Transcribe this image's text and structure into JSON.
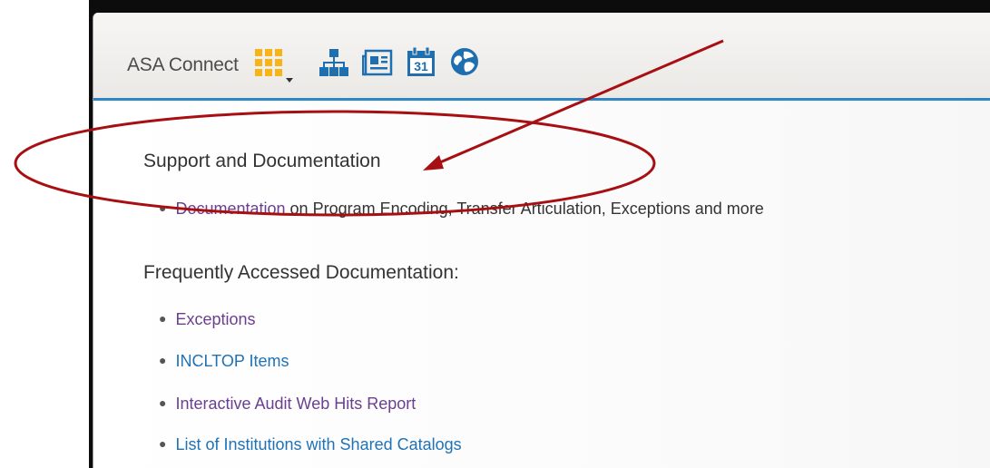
{
  "header": {
    "app_title": "ASA Connect",
    "calendar_day": "31",
    "icons": [
      "apps-grid-icon",
      "dropdown-caret-icon",
      "sitemap-icon",
      "news-icon",
      "calendar-icon",
      "globe-icon"
    ]
  },
  "support": {
    "heading": "Support and Documentation",
    "item": {
      "link": "Documentation",
      "rest": " on Program Encoding, Transfer Articulation, Exceptions and more"
    }
  },
  "frequent": {
    "heading": "Frequently Accessed Documentation:",
    "items": [
      {
        "label": "Exceptions"
      },
      {
        "label": "INCLTOP Items"
      },
      {
        "label": "Interactive Audit Web Hits Report"
      },
      {
        "label": "List of Institutions with Shared Catalogs"
      }
    ]
  },
  "colors": {
    "accent_blue": "#2d86c5",
    "annotation_red": "#a80f12",
    "grid_orange": "#f4b41a",
    "link_visited": "#6b3f8f",
    "link_blue": "#1f72b5"
  }
}
